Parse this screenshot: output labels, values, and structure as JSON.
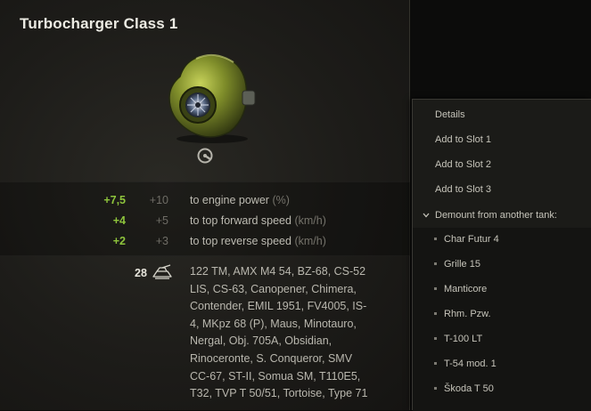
{
  "tooltip": {
    "title": "Turbocharger Class 1",
    "stats": [
      {
        "new": "+7,5",
        "base": "+10",
        "label": "to engine power",
        "unit": "(%)"
      },
      {
        "new": "+4",
        "base": "+5",
        "label": "to top forward speed",
        "unit": "(km/h)"
      },
      {
        "new": "+2",
        "base": "+3",
        "label": "to top reverse speed",
        "unit": "(km/h)"
      }
    ],
    "compatible_count": "28",
    "compatible_tanks": "122 TM, AMX M4 54, BZ-68, CS-52 LIS, CS-63, Canopener, Chimera, Contender, EMIL 1951, FV4005, IS-4, MKpz 68 (P), Maus, Minotauro, Nergal, Obj. 705A, Obsidian, Rinoceronte, S. Conqueror, SMV CC-67, ST-II, Somua SM, T110E5, T32, TVP T 50/51, Tortoise, Type 71"
  },
  "menu": {
    "items": [
      "Details",
      "Add to Slot 1",
      "Add to Slot 2",
      "Add to Slot 3"
    ],
    "demount_label": "Demount from another tank:",
    "tanks": [
      "Char Futur 4",
      "Grille 15",
      "Manticore",
      "Rhm. Pzw.",
      "T-100 LT",
      "T-54 mod. 1",
      "Škoda T 50"
    ]
  },
  "colors": {
    "bonus_green": "#8ec43c",
    "base_gray": "#6f6d66",
    "module_green": "#8a9a2e"
  },
  "icons": [
    "turbocharger-image",
    "role-icon",
    "tank-stack-icon",
    "chevron-down-icon"
  ]
}
